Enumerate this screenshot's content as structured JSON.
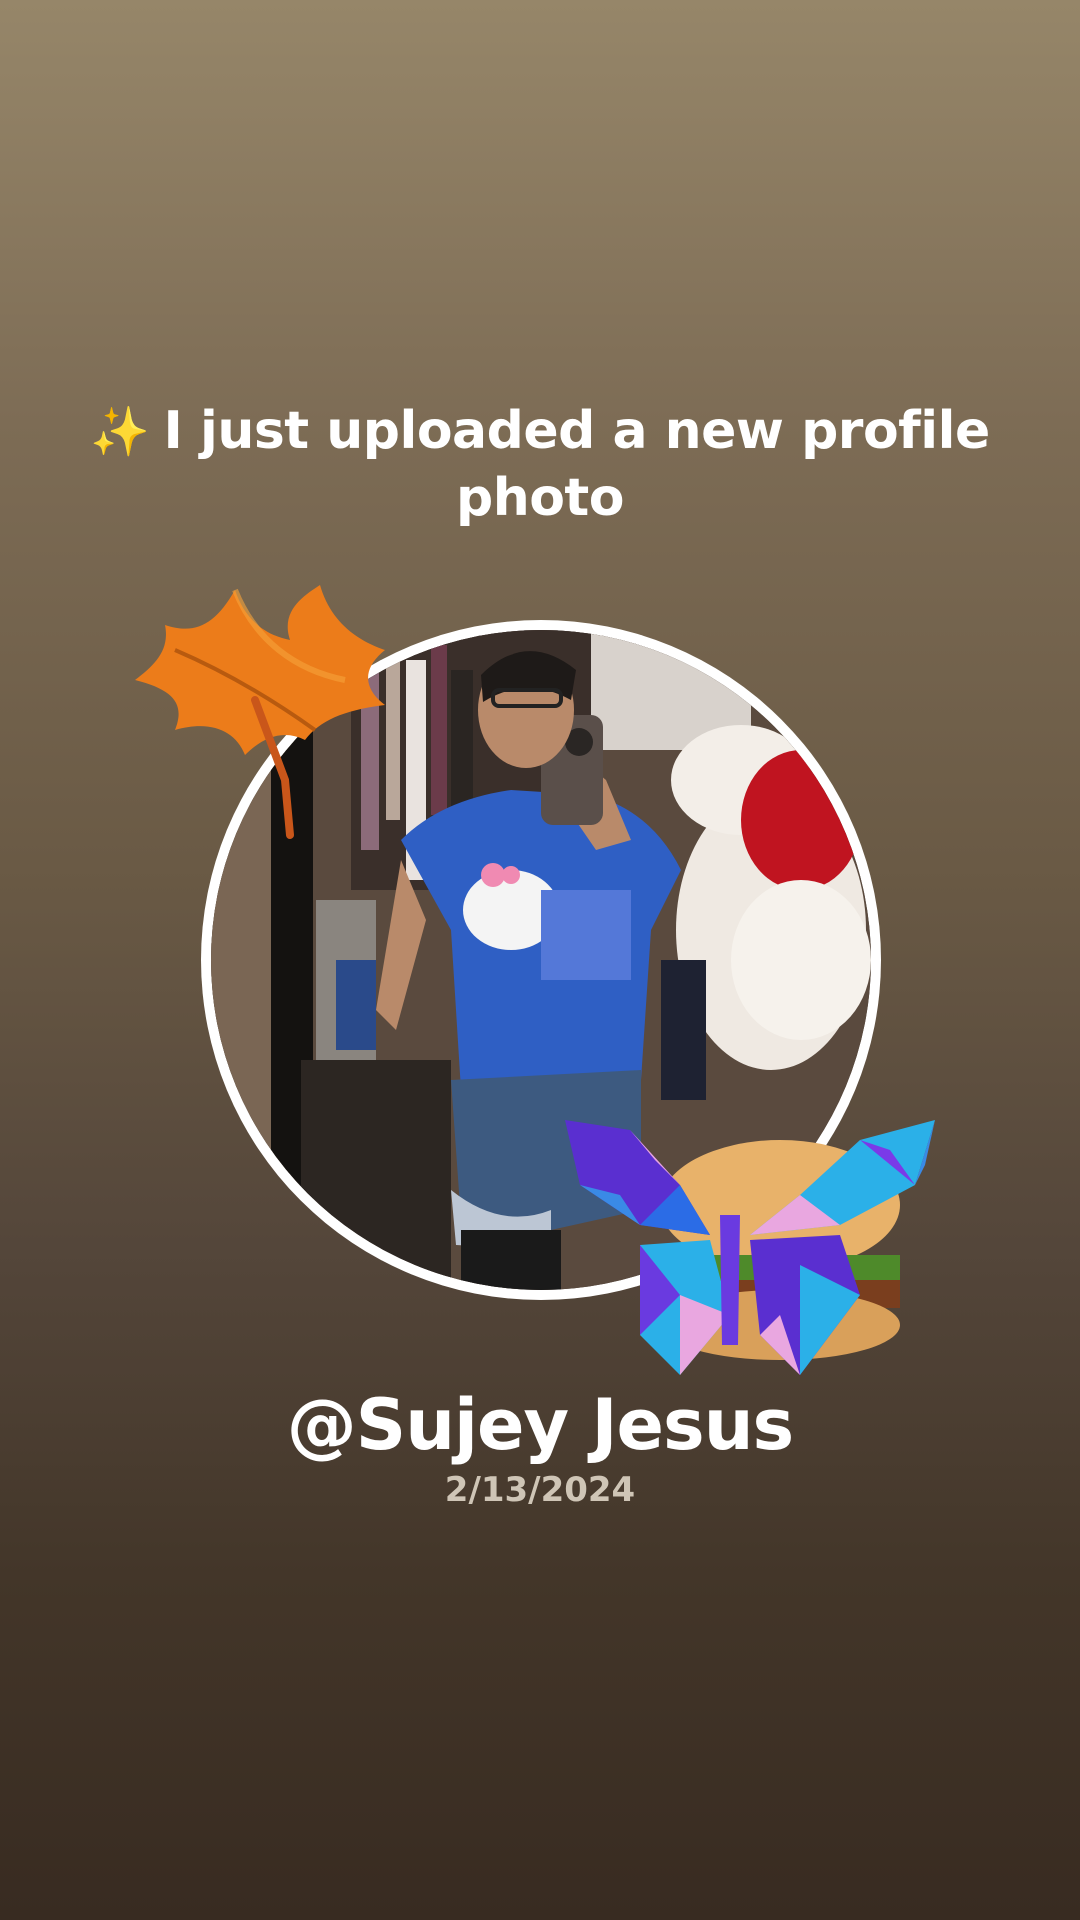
{
  "story": {
    "sparkle_icon": "sparkles-icon",
    "sparkle_glyph": "✨",
    "headline": "I just uploaded a new profile photo"
  },
  "profile": {
    "username": "@Sujey Jesus",
    "date": "2/13/2024",
    "photo_subject": "profile-photo"
  },
  "stickers": [
    "maple-leaf-icon",
    "crystal-butterfly-icon",
    "burger-icon"
  ],
  "colors": {
    "background_top": "#968669",
    "background_bottom": "#382b21",
    "text_primary": "#ffffff",
    "text_secondary": "#cfc5b6",
    "ring": "#ffffff"
  }
}
